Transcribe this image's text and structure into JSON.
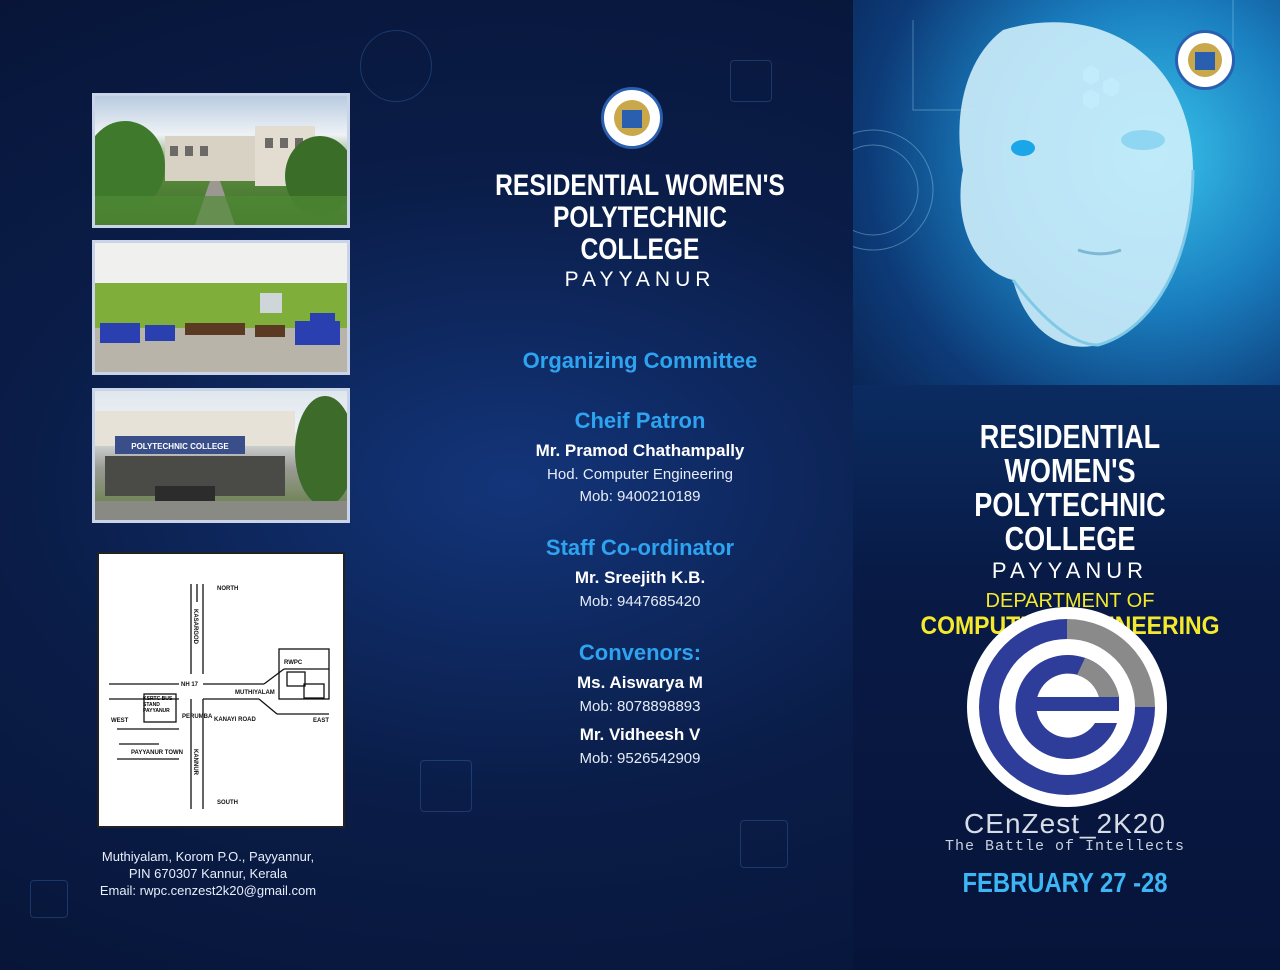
{
  "college": {
    "name_line1": "RESIDENTIAL WOMEN'S",
    "name_line2": "POLYTECHNIC COLLEGE",
    "place": "PAYYANUR"
  },
  "photos": [
    {
      "subject": "campus walkway and buildings"
    },
    {
      "subject": "computer lab"
    },
    {
      "subject": "college entrance building"
    }
  ],
  "photo_signboard": "POLYTECHNIC COLLEGE",
  "map": {
    "labels": {
      "north": "NORTH",
      "south": "SOUTH",
      "east": "EAST",
      "west": "WEST",
      "kasargod": "KASARGOD",
      "kannur": "KANNUR",
      "nh": "NH 17",
      "muthiyalam": "MUTHIYALAM",
      "rwpc": "RWPC",
      "perumba": "PERUMBA",
      "kanayi": "KANAYI ROAD",
      "bus_stand": "KSRTC BUS STAND PAYYANUR",
      "payyanur_town": "PAYYANUR TOWN"
    }
  },
  "address": {
    "line1": "Muthiyalam, Korom P.O., Payyannur,",
    "line2": "PIN 670307 Kannur, Kerala",
    "line3": "Email: rwpc.cenzest2k20@gmail.com"
  },
  "committee": {
    "heading": "Organizing Committee",
    "patron": {
      "heading": "Cheif Patron",
      "name": "Mr. Pramod Chathampally",
      "role": "Hod. Computer Engineering",
      "mobile": "Mob: 9400210189"
    },
    "staff": {
      "heading": "Staff Co-ordinator",
      "name": "Mr. Sreejith K.B.",
      "mobile": "Mob: 9447685420"
    },
    "convenors": {
      "heading": "Convenors:",
      "people": [
        {
          "name": "Ms. Aiswarya M",
          "mobile": "Mob: 8078898893"
        },
        {
          "name": "Mr. Vidheesh V",
          "mobile": "Mob: 9526542909"
        }
      ]
    }
  },
  "department": {
    "line1": "DEPARTMENT OF",
    "line2": "COMPUTER ENGINEERING"
  },
  "event": {
    "name": "CEnZest_2K20",
    "tagline": "The Battle of Intellects",
    "dates": "FEBRUARY 27 -28"
  },
  "colors": {
    "background": "#0a1d48",
    "heading_blue": "#2ea3f0",
    "department_yellow": "#f5e92c",
    "logo_blue": "#2f3d9a",
    "logo_grey": "#8a8a8a"
  },
  "icons": [
    "dte-emblem-icon",
    "robot-face-illustration",
    "cenzest-logo-icon"
  ]
}
